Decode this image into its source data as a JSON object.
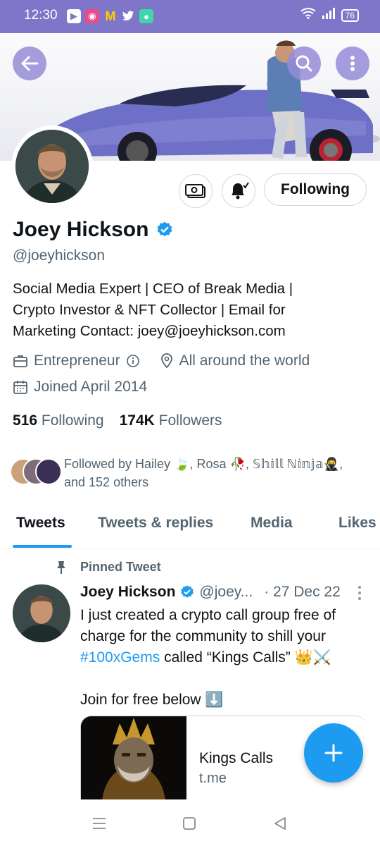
{
  "status_bar": {
    "time": "12:30",
    "battery": "76"
  },
  "profile": {
    "name": "Joey Hickson",
    "handle": "@joeyhickson",
    "follow_button": "Following",
    "bio": [
      "Social Media Expert | CEO of Break Media |",
      "Crypto Investor & NFT Collector | Email for",
      "Marketing Contact: joey@joeyhickson.com"
    ],
    "category": "Entrepreneur",
    "location": "All around the world",
    "joined": "Joined April 2014",
    "following_count": "516",
    "following_label": "Following",
    "followers_count": "174K",
    "followers_label": "Followers",
    "followed_by_line1": "Followed by Hailey 🍃, Rosa 🥀, 𝕊𝕙𝕚𝕝𝕝 ℕ𝕚𝕟𝕛𝕒🥷,",
    "followed_by_line2": "and 152 others"
  },
  "tabs": [
    "Tweets",
    "Tweets & replies",
    "Media",
    "Likes"
  ],
  "tweet": {
    "pinned_label": "Pinned Tweet",
    "author": "Joey Hickson",
    "handle": "@joey...",
    "date": "· 27 Dec 22",
    "text_line1": "I just created a crypto call group free of",
    "text_line2": "charge for the community to shill your",
    "hashtag": "#100xGems",
    "text_line3_rest": " called “Kings Calls” 👑⚔️",
    "text_line4": "Join for free below ⬇️",
    "card_title": "Kings Calls",
    "card_domain": "t.me"
  },
  "icons": {
    "back": "back-arrow-icon",
    "search": "search-icon",
    "more": "more-vertical-icon",
    "tip": "tip-money-icon",
    "bell": "notification-bell-icon",
    "verified": "verified-badge-icon",
    "briefcase": "briefcase-icon",
    "info": "info-icon",
    "location": "location-pin-icon",
    "calendar": "calendar-icon",
    "pin": "pin-icon",
    "compose": "plus-icon"
  },
  "colors": {
    "accent": "#1d9bf0",
    "status_bar": "#7f76c9",
    "text": "#0f1419",
    "secondary": "#536471"
  }
}
